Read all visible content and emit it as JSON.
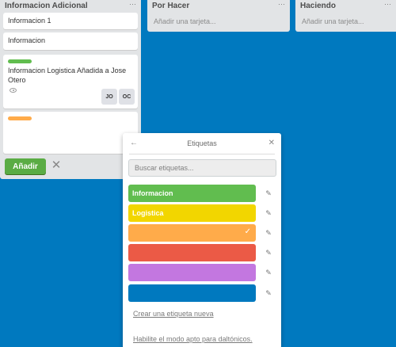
{
  "lists": {
    "info": {
      "title": "Informacion Adicional",
      "menu": "···",
      "cards": {
        "c1": {
          "text": "Informacion 1"
        },
        "c2": {
          "text": "Informacion"
        },
        "c3": {
          "label_color": "#61bd4f",
          "text_line1": "Informacion Logistica Añadida a Jose",
          "text_line2": "Otero",
          "icon": "eye-icon",
          "members": [
            "JO",
            "OC"
          ]
        },
        "c4": {
          "label_color": "#ffab4a",
          "text": ""
        }
      },
      "add_button": "Añadir",
      "cancel_icon": "✕"
    },
    "todo": {
      "title": "Por Hacer",
      "menu": "···",
      "add_card": "Añadir una tarjeta..."
    },
    "doing": {
      "title": "Haciendo",
      "menu": "···",
      "add_card": "Añadir una tarjeta..."
    }
  },
  "popover": {
    "back_icon": "←",
    "title": "Etiquetas",
    "close_icon": "✕",
    "search_placeholder": "Buscar etiquetas...",
    "labels": [
      {
        "name": "Informacion",
        "color": "#61bd4f",
        "selected": false
      },
      {
        "name": "Logistica",
        "color": "#f2d600",
        "selected": false
      },
      {
        "name": "",
        "color": "#ffab4a",
        "selected": true
      },
      {
        "name": "",
        "color": "#eb5a46",
        "selected": false
      },
      {
        "name": "",
        "color": "#c377e0",
        "selected": false
      },
      {
        "name": "",
        "color": "#0079bf",
        "selected": false
      }
    ],
    "check_icon": "✓",
    "edit_icon": "✎",
    "create_link": "Crear una etiqueta nueva",
    "colorblind_link": "Habilite el modo apto para daltónicos."
  },
  "colors": {
    "board": "#0079bf",
    "list": "#e2e4e6",
    "add_button": "#5aac44"
  }
}
